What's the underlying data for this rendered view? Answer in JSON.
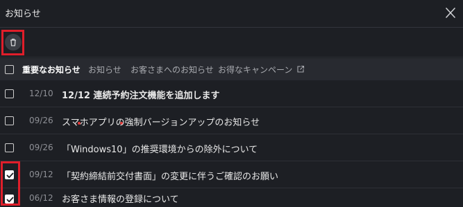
{
  "header": {
    "title": "お知らせ"
  },
  "icons": {
    "close": "close-icon",
    "trash": "trash-icon",
    "external": "external-link-icon"
  },
  "colors": {
    "highlight": "#e01e2a",
    "unread_dot": "#e23a3a",
    "background": "#1d1f24"
  },
  "tabs": [
    {
      "label": "重要なお知らせ",
      "active": true,
      "dot": true
    },
    {
      "label": "お知らせ",
      "active": false,
      "dot": true
    },
    {
      "label": "お客さまへのお知らせ",
      "active": false,
      "dot": false
    },
    {
      "label": "お得なキャンペーン",
      "active": false,
      "dot": false,
      "external": true
    }
  ],
  "notices": [
    {
      "date": "12/10",
      "subject": "12/12 連続予約注文機能を追加します",
      "bold": true,
      "checked": false
    },
    {
      "date": "09/26",
      "subject": "スマホアプリの強制バージョンアップのお知らせ",
      "bold": false,
      "checked": false
    },
    {
      "date": "09/26",
      "subject": "「Windows10」の推奨環境からの除外について",
      "bold": false,
      "checked": false
    },
    {
      "date": "09/12",
      "subject": "「契約締結前交付書面」の変更に伴うご確認のお願い",
      "bold": false,
      "checked": true
    },
    {
      "date": "06/12",
      "subject": "お客さま情報の登録について",
      "bold": false,
      "checked": true
    }
  ]
}
